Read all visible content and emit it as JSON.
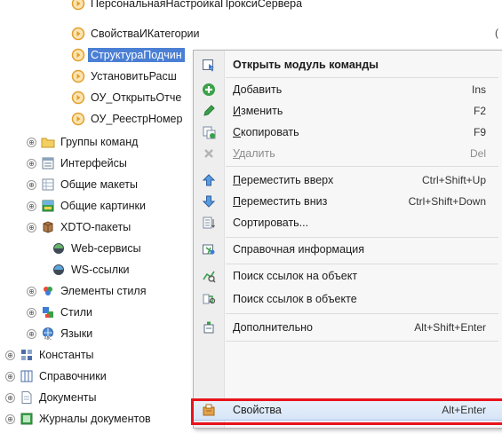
{
  "tree": {
    "items": [
      {
        "label": "ПерсональнаяНастройкаПроксиСервера",
        "expander": "",
        "icon": "module-icon"
      },
      {
        "label": "СвойстваИКатегории",
        "expander": "",
        "icon": "module-icon"
      },
      {
        "label": "СтруктураПодчин",
        "expander": "",
        "icon": "module-icon"
      },
      {
        "label": "УстановитьРасш",
        "expander": "",
        "icon": "module-icon"
      },
      {
        "label": "ОУ_ОткрытьОтче",
        "expander": "",
        "icon": "module-icon"
      },
      {
        "label": "ОУ_РеестрНомер",
        "expander": "",
        "icon": "module-icon"
      },
      {
        "label": "Группы команд",
        "expander": "⊕",
        "icon": "folder-icon"
      },
      {
        "label": "Интерфейсы",
        "expander": "⊕",
        "icon": "interface-icon"
      },
      {
        "label": "Общие макеты",
        "expander": "⊕",
        "icon": "layout-icon"
      },
      {
        "label": "Общие картинки",
        "expander": "⊕",
        "icon": "picture-icon"
      },
      {
        "label": "XDTO-пакеты",
        "expander": "⊕",
        "icon": "xdto-icon"
      },
      {
        "label": "Web-сервисы",
        "expander": "",
        "icon": "web-service-icon"
      },
      {
        "label": "WS-ссылки",
        "expander": "",
        "icon": "ws-link-icon"
      },
      {
        "label": "Элементы стиля",
        "expander": "⊕",
        "icon": "style-element-icon"
      },
      {
        "label": "Стили",
        "expander": "⊕",
        "icon": "style-icon"
      },
      {
        "label": "Языки",
        "expander": "⊕",
        "icon": "language-icon"
      },
      {
        "label": "Константы",
        "expander": "⊕",
        "icon": "constants-icon"
      },
      {
        "label": "Справочники",
        "expander": "⊕",
        "icon": "catalog-icon"
      },
      {
        "label": "Документы",
        "expander": "⊕",
        "icon": "document-icon"
      },
      {
        "label": "Журналы документов",
        "expander": "⊕",
        "icon": "journal-icon"
      }
    ],
    "edge_char": "("
  },
  "context_menu": {
    "items": [
      {
        "label": "Открыть модуль команды",
        "shortcut": "",
        "icon": "open-module-icon",
        "bold": true,
        "disabled": false
      },
      {
        "label": "Добавить",
        "shortcut": "Ins",
        "icon": "add-icon",
        "bold": false,
        "disabled": false
      },
      {
        "label": "Изменить",
        "shortcut": "F2",
        "icon": "edit-icon",
        "bold": false,
        "disabled": false
      },
      {
        "label": "Скопировать",
        "shortcut": "F9",
        "icon": "copy-icon",
        "bold": false,
        "disabled": false
      },
      {
        "label": "Удалить",
        "shortcut": "Del",
        "icon": "delete-icon",
        "bold": false,
        "disabled": true
      },
      {
        "label": "Переместить вверх",
        "shortcut": "Ctrl+Shift+Up",
        "icon": "move-up-icon",
        "bold": false,
        "disabled": false
      },
      {
        "label": "Переместить вниз",
        "shortcut": "Ctrl+Shift+Down",
        "icon": "move-down-icon",
        "bold": false,
        "disabled": false
      },
      {
        "label": "Сортировать...",
        "shortcut": "",
        "icon": "sort-icon",
        "bold": false,
        "disabled": false
      },
      {
        "label": "Справочная информация",
        "shortcut": "",
        "icon": "help-info-icon",
        "bold": false,
        "disabled": false
      },
      {
        "label": "Поиск ссылок на объект",
        "shortcut": "",
        "icon": "find-refs-to-icon",
        "bold": false,
        "disabled": false
      },
      {
        "label": "Поиск ссылок в объекте",
        "shortcut": "",
        "icon": "find-refs-in-icon",
        "bold": false,
        "disabled": false
      },
      {
        "label": "Дополнительно",
        "shortcut": "Alt+Shift+Enter",
        "icon": "advanced-icon",
        "bold": false,
        "disabled": false
      },
      {
        "label": "Свойства",
        "shortcut": "Alt+Enter",
        "icon": "properties-icon",
        "bold": false,
        "disabled": false
      }
    ]
  },
  "colors": {
    "selection": "#4a7fd4",
    "highlight_box": "#e8131b",
    "menu_bg": "#f7f7f7"
  }
}
